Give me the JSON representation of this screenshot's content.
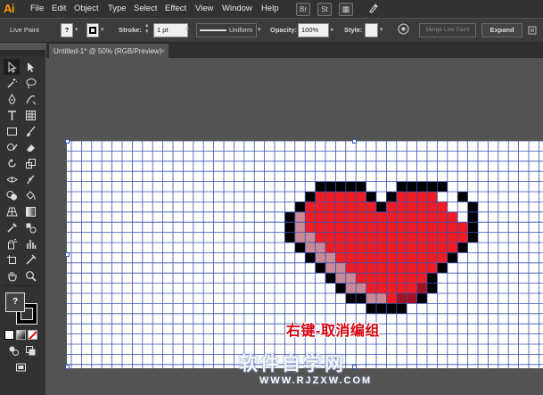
{
  "app": {
    "logo": "Ai"
  },
  "menu": [
    "File",
    "Edit",
    "Object",
    "Type",
    "Select",
    "Effect",
    "View",
    "Window",
    "Help"
  ],
  "menu_buttons": [
    "Br",
    "St"
  ],
  "control_bar": {
    "mode": "Live Paint",
    "fill_value": "?",
    "stroke_label": "Stroke:",
    "stroke_weight": "1 pt",
    "profile": "Uniform",
    "opacity_label": "Opacity:",
    "opacity_value": "100%",
    "style_label": "Style:",
    "merge_button": "Merge Live Paint",
    "expand_button": "Expand"
  },
  "document_tab": {
    "title": "Untitled-1* @ 50% (RGB/Preview)"
  },
  "toolbar": {
    "fill_indicator": "?"
  },
  "caption": "右键-取消编组",
  "watermark": {
    "title": "软件自学网",
    "url": "WWW.RJZXW.COM"
  },
  "colors": {
    "grid_line": "#3a4fb0",
    "outline": "#000000",
    "red": "#ee1d24",
    "dark_red": "#9e1420",
    "shadow_pink": "#c98a96",
    "highlight": "#ffffff",
    "caption": "#d8000e"
  }
}
